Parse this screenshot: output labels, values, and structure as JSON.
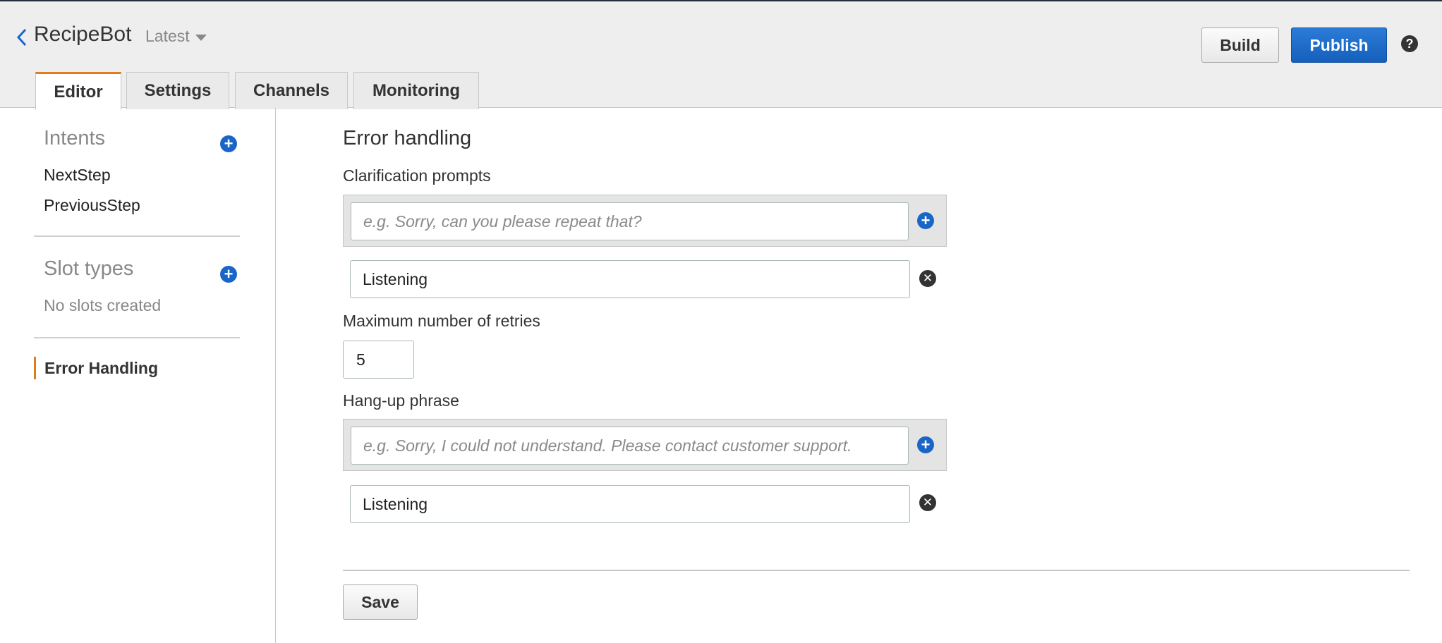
{
  "header": {
    "bot_name": "RecipeBot",
    "version": "Latest",
    "build_label": "Build",
    "publish_label": "Publish",
    "help_glyph": "?"
  },
  "tabs": [
    {
      "label": "Editor",
      "active": true
    },
    {
      "label": "Settings",
      "active": false
    },
    {
      "label": "Channels",
      "active": false
    },
    {
      "label": "Monitoring",
      "active": false
    }
  ],
  "sidebar": {
    "intents_title": "Intents",
    "intents": [
      "NextStep",
      "PreviousStep"
    ],
    "slot_types_title": "Slot types",
    "slot_types_empty": "No slots created",
    "error_handling": "Error Handling"
  },
  "main": {
    "title": "Error handling",
    "clarification_label": "Clarification prompts",
    "clarification_placeholder": "e.g. Sorry, can you please repeat that?",
    "clarification_value": "Listening",
    "retries_label": "Maximum number of retries",
    "retries_value": "5",
    "hangup_label": "Hang-up phrase",
    "hangup_placeholder": "e.g. Sorry, I could not understand. Please contact customer support.",
    "hangup_value": "Listening",
    "save_label": "Save"
  },
  "colors": {
    "accent_orange": "#e07b1f",
    "primary_blue": "#1a66c7",
    "publish_blue": "#1560bd"
  }
}
